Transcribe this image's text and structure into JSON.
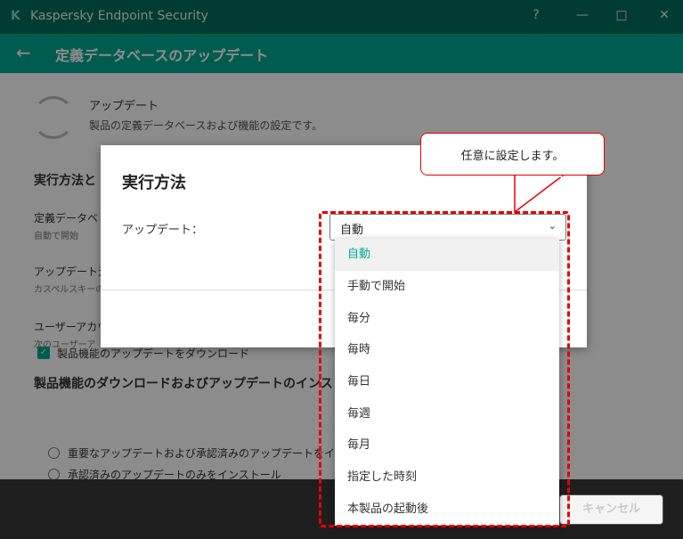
{
  "app": {
    "title": "Kaspersky Endpoint Security",
    "window_buttons": [
      "?",
      "—",
      "□",
      "✕"
    ]
  },
  "nav": {
    "back_icon": "←",
    "title": "定義データベースのアップデート"
  },
  "content": {
    "section_title": "アップデート",
    "section_desc": "製品の定義データベースおよび機能の設定です。",
    "exec_heading": "実行方法と",
    "rows": [
      {
        "label": "定義データベ",
        "sub": "自動で開始"
      },
      {
        "label": "アップデート元",
        "sub": "カスペルスキーの"
      },
      {
        "label": "ユーザーアカウ",
        "sub": "次のユーザーア"
      }
    ],
    "download_heading": "製品機能のダウンロードおよびアップデートのインストール",
    "checkbox_label": "製品機能のアップデートをダウンロード",
    "radio_1": "重要なアップデートおよび承認済みのアップデートをインストール",
    "radio_2": "承認済みのアップデートのみをインストール"
  },
  "footer": {
    "cancel_label": "キャンセル"
  },
  "dialog": {
    "title": "実行方法",
    "field_label": "アップデート：",
    "selected_value": "自動",
    "chevron_icon": "chevron-down",
    "options": [
      "自動",
      "手動で開始",
      "毎分",
      "毎時",
      "毎日",
      "毎週",
      "毎月",
      "指定した時刻",
      "本製品の起動後"
    ],
    "selected_index": 0
  },
  "callout": {
    "text": "任意に設定します。"
  },
  "colors": {
    "brand_dark": "#006d5b",
    "brand": "#00a88e",
    "highlight": "#e60000"
  }
}
